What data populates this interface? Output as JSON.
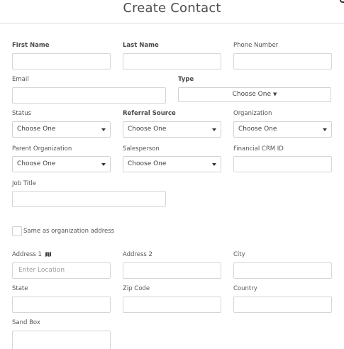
{
  "header": {
    "title": "Create Contact"
  },
  "form": {
    "first_name": {
      "label": "First Name",
      "value": ""
    },
    "last_name": {
      "label": "Last Name",
      "value": ""
    },
    "phone_number": {
      "label": "Phone Number",
      "value": ""
    },
    "email": {
      "label": "Email",
      "value": ""
    },
    "type": {
      "label": "Type",
      "value": "Choose One"
    },
    "status": {
      "label": "Status",
      "value": "Choose One"
    },
    "referral_source": {
      "label": "Referral Source",
      "value": "Choose One"
    },
    "organization": {
      "label": "Organization",
      "value": "Choose One"
    },
    "parent_organization": {
      "label": "Parent Organization",
      "value": "Choose One"
    },
    "salesperson": {
      "label": "Salesperson",
      "value": "Choose One"
    },
    "financial_crm_id": {
      "label": "Financial CRM ID",
      "value": ""
    },
    "job_title": {
      "label": "Job Title",
      "value": ""
    },
    "same_as_org_address": {
      "label": "Same as organization address",
      "checked": false
    },
    "address1": {
      "label": "Address 1",
      "placeholder": "Enter Location",
      "icon": "map-icon"
    },
    "address2": {
      "label": "Address 2",
      "value": ""
    },
    "city": {
      "label": "City",
      "value": ""
    },
    "state": {
      "label": "State",
      "value": ""
    },
    "zip_code": {
      "label": "Zip Code",
      "value": ""
    },
    "country": {
      "label": "Country",
      "value": ""
    },
    "sand_box": {
      "label": "Sand Box",
      "value": ""
    }
  }
}
